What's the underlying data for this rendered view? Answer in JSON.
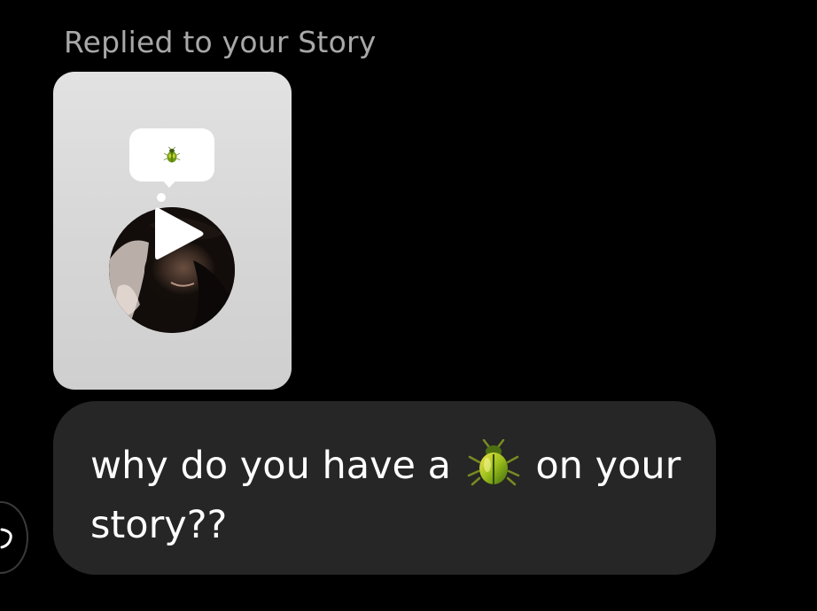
{
  "reply_context": {
    "label": "Replied to your Story"
  },
  "story_preview": {
    "sticker_icon": "beetle-emoji",
    "avatar_icon": "person-photo",
    "play_icon": "play-icon"
  },
  "message": {
    "text_before": "why do you have a",
    "emoji": "beetle-emoji",
    "text_after": "on your story??"
  },
  "side_action": {
    "icon": "reply-arrow-icon"
  },
  "colors": {
    "background": "#000000",
    "label_text": "#a8a8a8",
    "bubble_bg": "#262626",
    "message_text": "#ffffff",
    "card_bg": "#d6d6d6"
  }
}
